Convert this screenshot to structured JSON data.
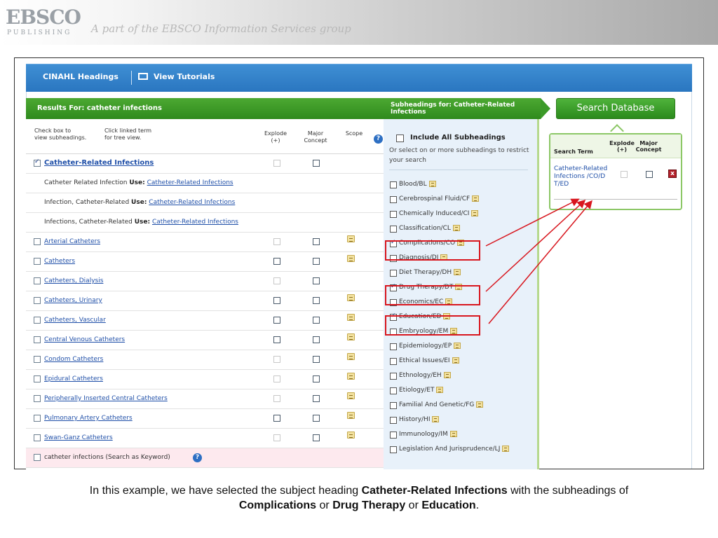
{
  "banner": {
    "logo_text": "EBSCO",
    "logo_sub": "PUBLISHING",
    "tagline": "A part of the EBSCO Information Services group"
  },
  "topbar": {
    "headings_label": "CINAHL Headings",
    "tutorials_label": "View Tutorials"
  },
  "results": {
    "title": "Results For: catheter infections",
    "instr_checkbox": "Check box to\nview subheadings.",
    "instr_link": "Click linked term\nfor tree view.",
    "col_explode": "Explode\n(+)",
    "col_major": "Major\nConcept",
    "col_scope": "Scope",
    "main_term": "Catheter-Related Infections",
    "use_word": "Use:",
    "see_rows": [
      {
        "text": "Catheter Related Infection",
        "target": "Catheter-Related Infections"
      },
      {
        "text": "Infection, Catheter-Related",
        "target": "Catheter-Related Infections"
      },
      {
        "text": "Infections, Catheter-Related",
        "target": "Catheter-Related Infections"
      }
    ],
    "terms": [
      {
        "label": "Arterial Catheters",
        "explode_enabled": false,
        "scope": true
      },
      {
        "label": "Catheters",
        "explode_enabled": true,
        "scope": true
      },
      {
        "label": "Catheters, Dialysis",
        "explode_enabled": false,
        "scope": false
      },
      {
        "label": "Catheters, Urinary",
        "explode_enabled": true,
        "scope": true
      },
      {
        "label": "Catheters, Vascular",
        "explode_enabled": true,
        "scope": true
      },
      {
        "label": "Central Venous Catheters",
        "explode_enabled": true,
        "scope": true
      },
      {
        "label": "Condom Catheters",
        "explode_enabled": false,
        "scope": true
      },
      {
        "label": "Epidural Catheters",
        "explode_enabled": false,
        "scope": true
      },
      {
        "label": "Peripherally Inserted Central Catheters",
        "explode_enabled": false,
        "scope": true
      },
      {
        "label": "Pulmonary Artery Catheters",
        "explode_enabled": true,
        "scope": true
      },
      {
        "label": "Swan-Ganz Catheters",
        "explode_enabled": false,
        "scope": true
      }
    ],
    "keyword_row": "catheter infections (Search as Keyword)"
  },
  "subheadings": {
    "title": "Subheadings for: Catheter-Related Infections",
    "include_all": "Include All Subheadings",
    "instruction": "Or select on or more subheadings to restrict your search",
    "items": [
      {
        "label": "Blood/BL",
        "checked": false
      },
      {
        "label": "Cerebrospinal Fluid/CF",
        "checked": false
      },
      {
        "label": "Chemically Induced/CI",
        "checked": false
      },
      {
        "label": "Classification/CL",
        "checked": false
      },
      {
        "label": "Complications/CO",
        "checked": true
      },
      {
        "label": "Diagnosis/DI",
        "checked": false
      },
      {
        "label": "Diet Therapy/DH",
        "checked": false
      },
      {
        "label": "Drug Therapy/DT",
        "checked": true
      },
      {
        "label": "Economics/EC",
        "checked": false
      },
      {
        "label": "Education/ED",
        "checked": true
      },
      {
        "label": "Embryology/EM",
        "checked": false
      },
      {
        "label": "Epidemiology/EP",
        "checked": false
      },
      {
        "label": "Ethical Issues/EI",
        "checked": false
      },
      {
        "label": "Ethnology/EH",
        "checked": false
      },
      {
        "label": "Etiology/ET",
        "checked": false
      },
      {
        "label": "Familial And Genetic/FG",
        "checked": false
      },
      {
        "label": "History/HI",
        "checked": false
      },
      {
        "label": "Immunology/IM",
        "checked": false
      },
      {
        "label": "Legislation And Jurisprudence/LJ",
        "checked": false
      }
    ]
  },
  "selection": {
    "search_button": "Search Database",
    "col_term": "Search Term",
    "col_explode": "Explode\n(+)",
    "col_major": "Major\nConcept",
    "selected_term": "Catheter-Related Infections /CO/D T/ED",
    "remove_label": "x"
  },
  "caption": {
    "part1": "In this example, we have selected the subject heading ",
    "b1": "Catheter-Related Infections",
    "part2": " with the subheadings of ",
    "b2": "Complications",
    "part3": " or ",
    "b3": "Drug Therapy",
    "part4": " or ",
    "b4": "Education",
    "part5": "."
  },
  "colors": {
    "accent_blue": "#2a76c0",
    "accent_green": "#3b9a28",
    "highlight_red": "#d8161e",
    "link": "#1f4fa8"
  }
}
